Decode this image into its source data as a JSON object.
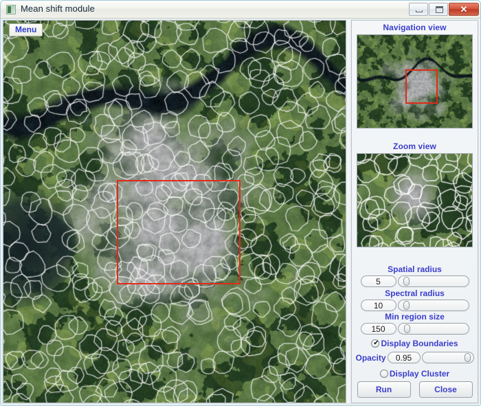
{
  "window": {
    "title": "Mean shift module",
    "icon": "image-module-icon",
    "buttons": {
      "minimize": "minimize-button",
      "maximize": "maximize-button",
      "close_glyph": "✕"
    }
  },
  "main_view": {
    "menu_label": "Menu",
    "selection_rect": "red-selection-rectangle"
  },
  "panels": {
    "navigation": {
      "title": "Navigation view"
    },
    "zoom": {
      "title": "Zoom view"
    }
  },
  "controls": {
    "spatial_radius": {
      "label": "Spatial radius",
      "value": "5",
      "slider_pct": 6
    },
    "spectral_radius": {
      "label": "Spectral radius",
      "value": "10",
      "slider_pct": 6
    },
    "min_region_size": {
      "label": "Min region size",
      "value": "150",
      "slider_pct": 8
    },
    "display_boundaries": {
      "label": "Display Boundaries",
      "checked": true
    },
    "opacity": {
      "label": "Opacity",
      "value": "0.95",
      "slider_pct": 92
    },
    "display_cluster": {
      "label": "Display Cluster",
      "checked": false
    },
    "run_button": "Run",
    "close_button": "Close"
  },
  "colors": {
    "label_blue": "#3b3ecb",
    "selection_red": "#e02b18",
    "title_text": "#12263d",
    "close_button_red": "#bc3b24"
  }
}
